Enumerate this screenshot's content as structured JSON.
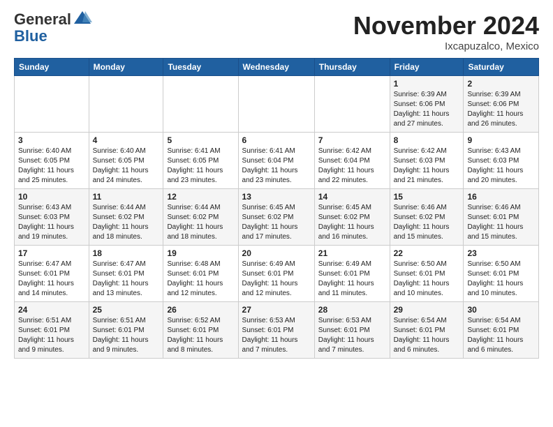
{
  "header": {
    "logo_general": "General",
    "logo_blue": "Blue",
    "month": "November 2024",
    "location": "Ixcapuzalco, Mexico"
  },
  "days_of_week": [
    "Sunday",
    "Monday",
    "Tuesday",
    "Wednesday",
    "Thursday",
    "Friday",
    "Saturday"
  ],
  "weeks": [
    [
      {
        "day": "",
        "info": ""
      },
      {
        "day": "",
        "info": ""
      },
      {
        "day": "",
        "info": ""
      },
      {
        "day": "",
        "info": ""
      },
      {
        "day": "",
        "info": ""
      },
      {
        "day": "1",
        "info": "Sunrise: 6:39 AM\nSunset: 6:06 PM\nDaylight: 11 hours\nand 27 minutes."
      },
      {
        "day": "2",
        "info": "Sunrise: 6:39 AM\nSunset: 6:06 PM\nDaylight: 11 hours\nand 26 minutes."
      }
    ],
    [
      {
        "day": "3",
        "info": "Sunrise: 6:40 AM\nSunset: 6:05 PM\nDaylight: 11 hours\nand 25 minutes."
      },
      {
        "day": "4",
        "info": "Sunrise: 6:40 AM\nSunset: 6:05 PM\nDaylight: 11 hours\nand 24 minutes."
      },
      {
        "day": "5",
        "info": "Sunrise: 6:41 AM\nSunset: 6:05 PM\nDaylight: 11 hours\nand 23 minutes."
      },
      {
        "day": "6",
        "info": "Sunrise: 6:41 AM\nSunset: 6:04 PM\nDaylight: 11 hours\nand 23 minutes."
      },
      {
        "day": "7",
        "info": "Sunrise: 6:42 AM\nSunset: 6:04 PM\nDaylight: 11 hours\nand 22 minutes."
      },
      {
        "day": "8",
        "info": "Sunrise: 6:42 AM\nSunset: 6:03 PM\nDaylight: 11 hours\nand 21 minutes."
      },
      {
        "day": "9",
        "info": "Sunrise: 6:43 AM\nSunset: 6:03 PM\nDaylight: 11 hours\nand 20 minutes."
      }
    ],
    [
      {
        "day": "10",
        "info": "Sunrise: 6:43 AM\nSunset: 6:03 PM\nDaylight: 11 hours\nand 19 minutes."
      },
      {
        "day": "11",
        "info": "Sunrise: 6:44 AM\nSunset: 6:02 PM\nDaylight: 11 hours\nand 18 minutes."
      },
      {
        "day": "12",
        "info": "Sunrise: 6:44 AM\nSunset: 6:02 PM\nDaylight: 11 hours\nand 18 minutes."
      },
      {
        "day": "13",
        "info": "Sunrise: 6:45 AM\nSunset: 6:02 PM\nDaylight: 11 hours\nand 17 minutes."
      },
      {
        "day": "14",
        "info": "Sunrise: 6:45 AM\nSunset: 6:02 PM\nDaylight: 11 hours\nand 16 minutes."
      },
      {
        "day": "15",
        "info": "Sunrise: 6:46 AM\nSunset: 6:02 PM\nDaylight: 11 hours\nand 15 minutes."
      },
      {
        "day": "16",
        "info": "Sunrise: 6:46 AM\nSunset: 6:01 PM\nDaylight: 11 hours\nand 15 minutes."
      }
    ],
    [
      {
        "day": "17",
        "info": "Sunrise: 6:47 AM\nSunset: 6:01 PM\nDaylight: 11 hours\nand 14 minutes."
      },
      {
        "day": "18",
        "info": "Sunrise: 6:47 AM\nSunset: 6:01 PM\nDaylight: 11 hours\nand 13 minutes."
      },
      {
        "day": "19",
        "info": "Sunrise: 6:48 AM\nSunset: 6:01 PM\nDaylight: 11 hours\nand 12 minutes."
      },
      {
        "day": "20",
        "info": "Sunrise: 6:49 AM\nSunset: 6:01 PM\nDaylight: 11 hours\nand 12 minutes."
      },
      {
        "day": "21",
        "info": "Sunrise: 6:49 AM\nSunset: 6:01 PM\nDaylight: 11 hours\nand 11 minutes."
      },
      {
        "day": "22",
        "info": "Sunrise: 6:50 AM\nSunset: 6:01 PM\nDaylight: 11 hours\nand 10 minutes."
      },
      {
        "day": "23",
        "info": "Sunrise: 6:50 AM\nSunset: 6:01 PM\nDaylight: 11 hours\nand 10 minutes."
      }
    ],
    [
      {
        "day": "24",
        "info": "Sunrise: 6:51 AM\nSunset: 6:01 PM\nDaylight: 11 hours\nand 9 minutes."
      },
      {
        "day": "25",
        "info": "Sunrise: 6:51 AM\nSunset: 6:01 PM\nDaylight: 11 hours\nand 9 minutes."
      },
      {
        "day": "26",
        "info": "Sunrise: 6:52 AM\nSunset: 6:01 PM\nDaylight: 11 hours\nand 8 minutes."
      },
      {
        "day": "27",
        "info": "Sunrise: 6:53 AM\nSunset: 6:01 PM\nDaylight: 11 hours\nand 7 minutes."
      },
      {
        "day": "28",
        "info": "Sunrise: 6:53 AM\nSunset: 6:01 PM\nDaylight: 11 hours\nand 7 minutes."
      },
      {
        "day": "29",
        "info": "Sunrise: 6:54 AM\nSunset: 6:01 PM\nDaylight: 11 hours\nand 6 minutes."
      },
      {
        "day": "30",
        "info": "Sunrise: 6:54 AM\nSunset: 6:01 PM\nDaylight: 11 hours\nand 6 minutes."
      }
    ]
  ]
}
